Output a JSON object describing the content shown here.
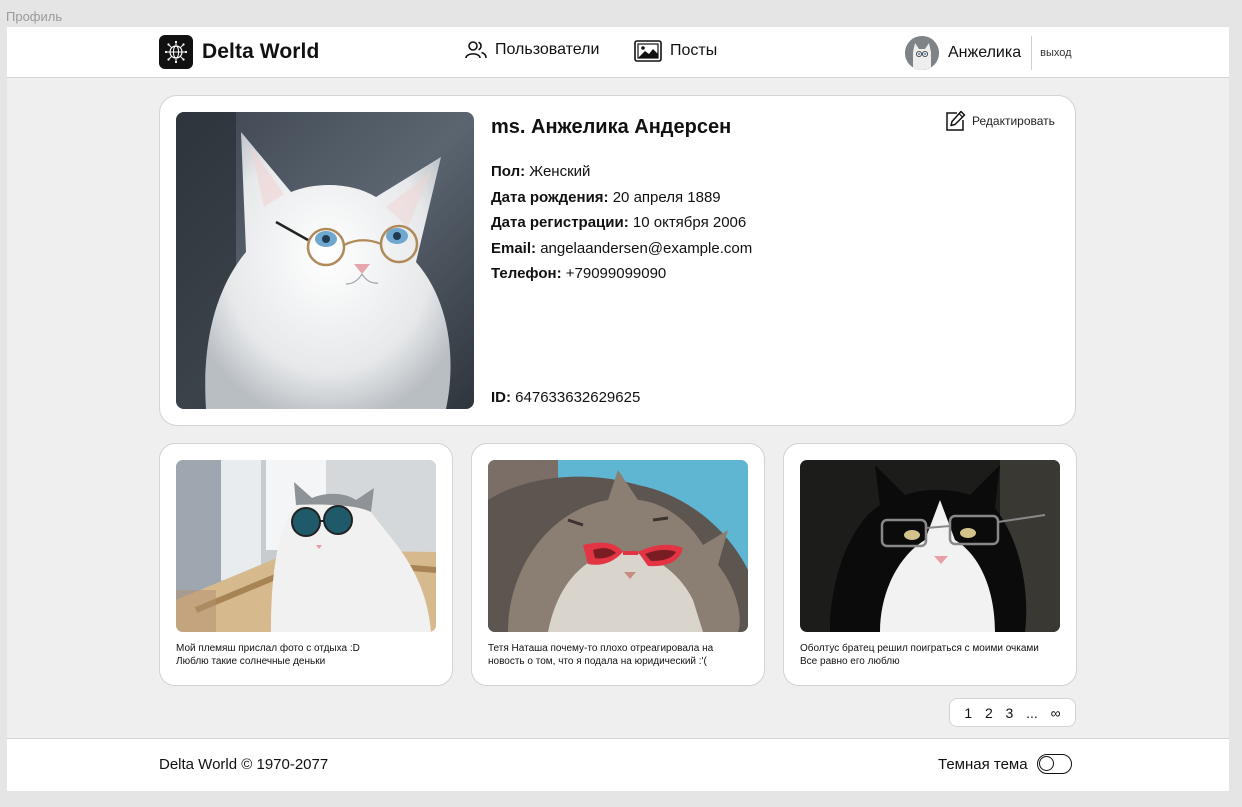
{
  "frame_label": "Профиль",
  "header": {
    "logo_text": "Delta World",
    "nav": [
      {
        "label": "Пользователи",
        "icon": "users-icon"
      },
      {
        "label": "Посты",
        "icon": "image-icon"
      }
    ],
    "user_name": "Анжелика",
    "logout_label": "выход"
  },
  "profile": {
    "name": "ms. Анжелика Андерсен",
    "edit_label": "Редактировать",
    "fields": [
      {
        "label": "Пол:",
        "value": "Женский"
      },
      {
        "label": "Дата рождения:",
        "value": "20 апреля 1889"
      },
      {
        "label": "Дата регистрации:",
        "value": "10 октября 2006"
      },
      {
        "label": "Email:",
        "value": "angelaandersen@example.com"
      },
      {
        "label": "Телефон:",
        "value": "+79099099090"
      }
    ],
    "id_label": "ID:",
    "id_value": "647633632629625"
  },
  "posts": [
    {
      "line1": "Мой племяш прислал фото с отдыха :D",
      "line2": "Люблю такие солнечные деньки"
    },
    {
      "line1": "Тетя Наташа почему-то плохо отреагировала на",
      "line2": "новость о том, что я подала на юридический :'("
    },
    {
      "line1": "Оболтус братец решил поиграться с моими очками",
      "line2": "Все равно его люблю"
    }
  ],
  "pagination": [
    "1",
    "2",
    "3",
    "...",
    "∞"
  ],
  "footer": {
    "copyright": "Delta World © 1970-2077",
    "theme_label": "Темная тема"
  }
}
